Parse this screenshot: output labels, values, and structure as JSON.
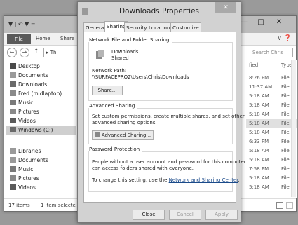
{
  "explorer": {
    "quick_access": "▼ | ↶ ▼ =",
    "ribbon": {
      "file": "File",
      "home": "Home",
      "share": "Share"
    },
    "address": "▸ Th",
    "search_placeholder": "Search Chris",
    "nav_items": [
      {
        "label": "Desktop"
      },
      {
        "label": "Documents"
      },
      {
        "label": "Downloads"
      },
      {
        "label": "Fred (midlaptop)"
      },
      {
        "label": "Music"
      },
      {
        "label": "Pictures"
      },
      {
        "label": "Videos"
      },
      {
        "label": "Windows (C:)"
      },
      {
        "label": "Libraries"
      },
      {
        "label": "Documents"
      },
      {
        "label": "Music"
      },
      {
        "label": "Pictures"
      },
      {
        "label": "Videos"
      }
    ],
    "columns": {
      "modified": "fied",
      "type": "Type"
    },
    "rows": [
      {
        "time": "8:26 PM",
        "type": "File f"
      },
      {
        "time": "11:37 AM",
        "type": "File f"
      },
      {
        "time": "5:18 AM",
        "type": "File f"
      },
      {
        "time": "5:18 AM",
        "type": "File f"
      },
      {
        "time": "5:18 AM",
        "type": "File f"
      },
      {
        "time": "5:18 AM",
        "type": "File f"
      },
      {
        "time": "5:18 AM",
        "type": "File f"
      },
      {
        "time": "6:33 PM",
        "type": "File f"
      },
      {
        "time": "5:18 AM",
        "type": "File f"
      },
      {
        "time": "5:18 AM",
        "type": "File f"
      },
      {
        "time": "7:58 PM",
        "type": "File f"
      },
      {
        "time": "5:18 AM",
        "type": "File f"
      },
      {
        "time": "5:18 AM",
        "type": "File f"
      }
    ],
    "status": {
      "items": "17 items",
      "selected": "1 item selecte"
    }
  },
  "dialog": {
    "title": "Downloads Properties",
    "close": "✕",
    "tabs": [
      "General",
      "Sharing",
      "Security",
      "Location",
      "Customize"
    ],
    "network_group_title": "Network File and Folder Sharing",
    "folder_name": "Downloads",
    "folder_state": "Shared",
    "network_path_label": "Network Path:",
    "network_path": "\\\\SURFACEPRO2\\Users\\Chris\\Downloads",
    "share_button": "Share...",
    "advanced_group_title": "Advanced Sharing",
    "advanced_text_1": "Set custom permissions, create multiple shares, and set other",
    "advanced_text_2": "advanced sharing options.",
    "advanced_button": "Advanced Sharing...",
    "password_group_title": "Password Protection",
    "password_text_1": "People without a user account and password for this computer",
    "password_text_2": "can access folders shared with everyone.",
    "password_change_prefix": "To change this setting, use the ",
    "password_link": "Network and Sharing Center",
    "password_change_suffix": ".",
    "buttons": {
      "close": "Close",
      "cancel": "Cancel",
      "apply": "Apply"
    }
  },
  "colors": {
    "accent_file_tab": "#5a5a5a",
    "link": "#1a4a8a",
    "selected_row": "#cfcfcf"
  }
}
